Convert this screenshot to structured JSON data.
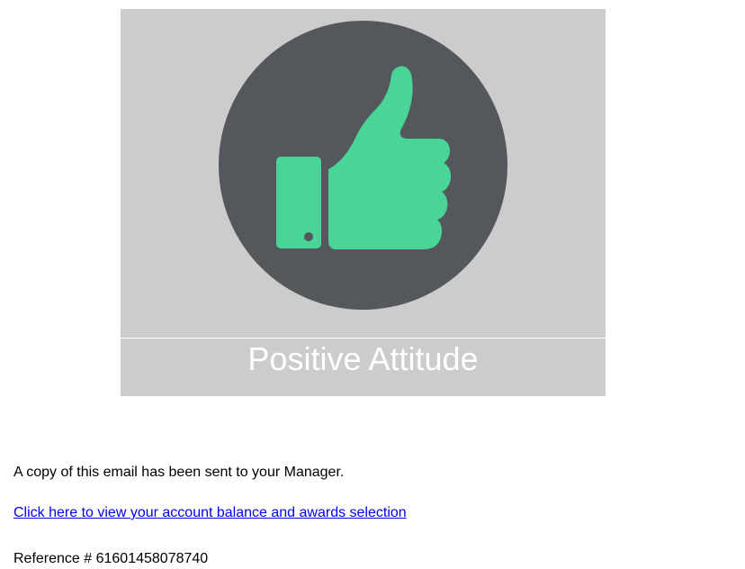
{
  "award": {
    "title": "Positive Attitude",
    "icon": "thumbs-up-icon",
    "colors": {
      "card_background": "#cccccc",
      "badge_circle": "#54575c",
      "icon_fill": "#48d597",
      "title_text": "#ffffff"
    }
  },
  "message": {
    "manager_notice": "A copy of this email has been sent to your Manager.",
    "account_link": "Click here to view your account balance and awards selection",
    "reference": "Reference # 61601458078740"
  },
  "colors": {
    "link": "#0000ee",
    "text": "#000000"
  }
}
